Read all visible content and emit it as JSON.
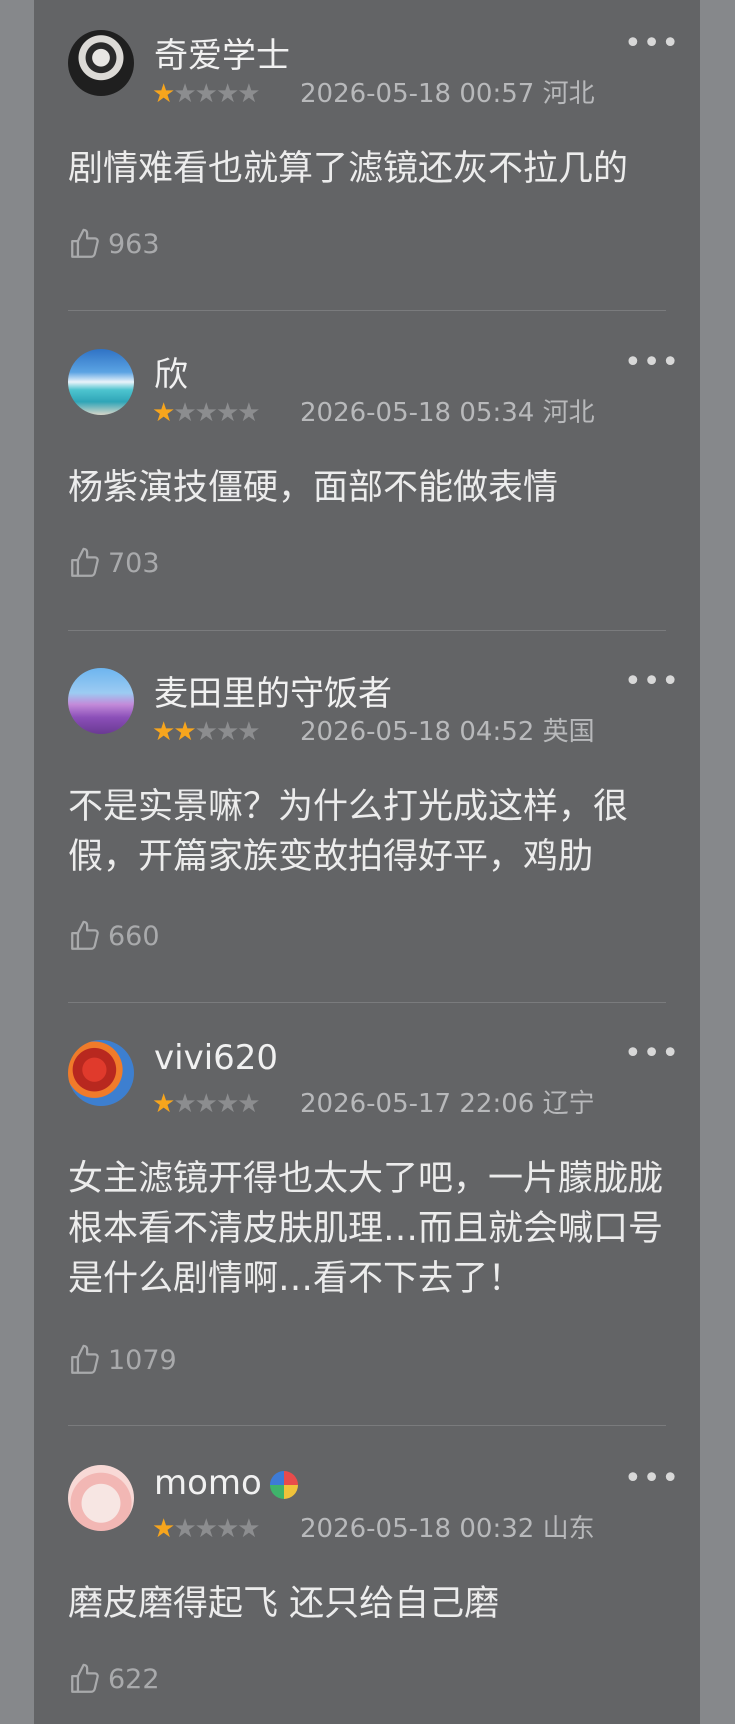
{
  "comments": [
    {
      "user": "奇爱学士",
      "rating": 1,
      "date": "2026-05-18 00:57",
      "location": "河北",
      "text": "剧情难看也就算了滤镜还灰不拉几的",
      "likes": "963"
    },
    {
      "user": "欣",
      "rating": 1,
      "date": "2026-05-18 05:34",
      "location": "河北",
      "text": "杨紫演技僵硬，面部不能做表情",
      "likes": "703"
    },
    {
      "user": "麦田里的守饭者",
      "rating": 2,
      "date": "2026-05-18 04:52",
      "location": "英国",
      "text": "不是实景嘛？为什么打光成这样，很假，开篇家族变故拍得好平，鸡肋",
      "likes": "660"
    },
    {
      "user": "vivi620",
      "rating": 1,
      "date": "2026-05-17 22:06",
      "location": "辽宁",
      "text": "女主滤镜开得也太大了吧，一片朦胧胧根本看不清皮肤肌理…而且就会喊口号是什么剧情啊…看不下去了！",
      "likes": "1079"
    },
    {
      "user": "momo",
      "rating": 1,
      "date": "2026-05-18 00:32",
      "location": "山东",
      "text": "磨皮磨得起飞 还只给自己磨",
      "likes": "622"
    }
  ],
  "icons": {
    "more": "more-dots-icon",
    "like": "thumbs-up-icon",
    "star_filled": "star-filled-icon",
    "star_empty": "star-empty-icon"
  },
  "colors": {
    "star_active": "#f7a51d",
    "panel_bg": "#636466"
  }
}
